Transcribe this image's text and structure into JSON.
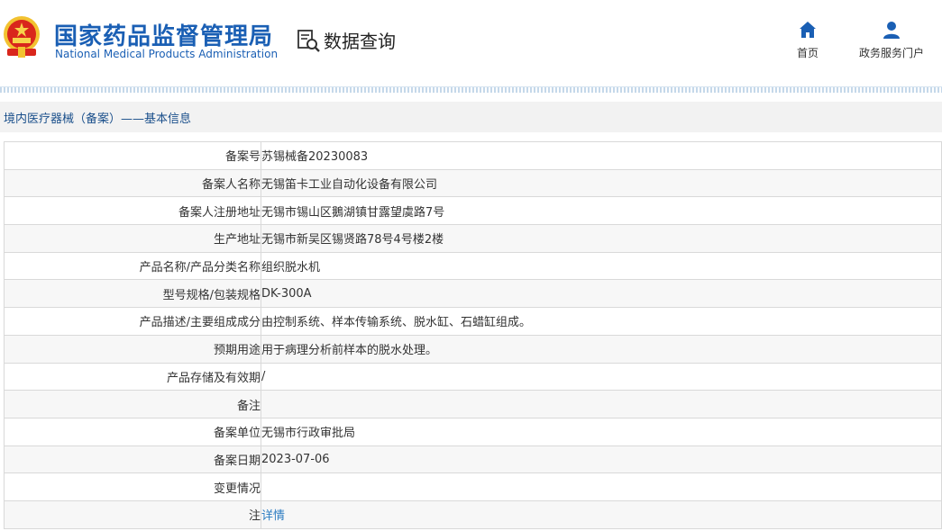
{
  "header": {
    "org_name_cn": "国家药品监督管理局",
    "org_name_en": "National Medical Products Administration",
    "query_label": "数据查询",
    "nav": {
      "home_label": "首页",
      "portal_label": "政务服务门户"
    }
  },
  "breadcrumb": {
    "text": "境内医疗器械（备案）——基本信息"
  },
  "record": {
    "rows": [
      {
        "label": "备案号",
        "value": "苏锡械备20230083"
      },
      {
        "label": "备案人名称",
        "value": "无锡笛卡工业自动化设备有限公司"
      },
      {
        "label": "备案人注册地址",
        "value": "无锡市锡山区鵝湖镇甘露望虞路7号"
      },
      {
        "label": "生产地址",
        "value": "无锡市新吴区锡贤路78号4号楼2楼"
      },
      {
        "label": "产品名称/产品分类名称",
        "value": "组织脱水机"
      },
      {
        "label": "型号规格/包装规格",
        "value": "DK-300A"
      },
      {
        "label": "产品描述/主要组成成分",
        "value": "由控制系统、样本传输系统、脱水缸、石蜡缸组成。"
      },
      {
        "label": "预期用途",
        "value": "用于病理分析前样本的脱水处理。"
      },
      {
        "label": "产品存储及有效期",
        "value": "/"
      },
      {
        "label": "备注",
        "value": ""
      },
      {
        "label": "备案单位",
        "value": "无锡市行政审批局"
      },
      {
        "label": "备案日期",
        "value": "2023-07-06"
      },
      {
        "label": "变更情况",
        "value": ""
      },
      {
        "label": "注",
        "value": "详情"
      }
    ]
  }
}
